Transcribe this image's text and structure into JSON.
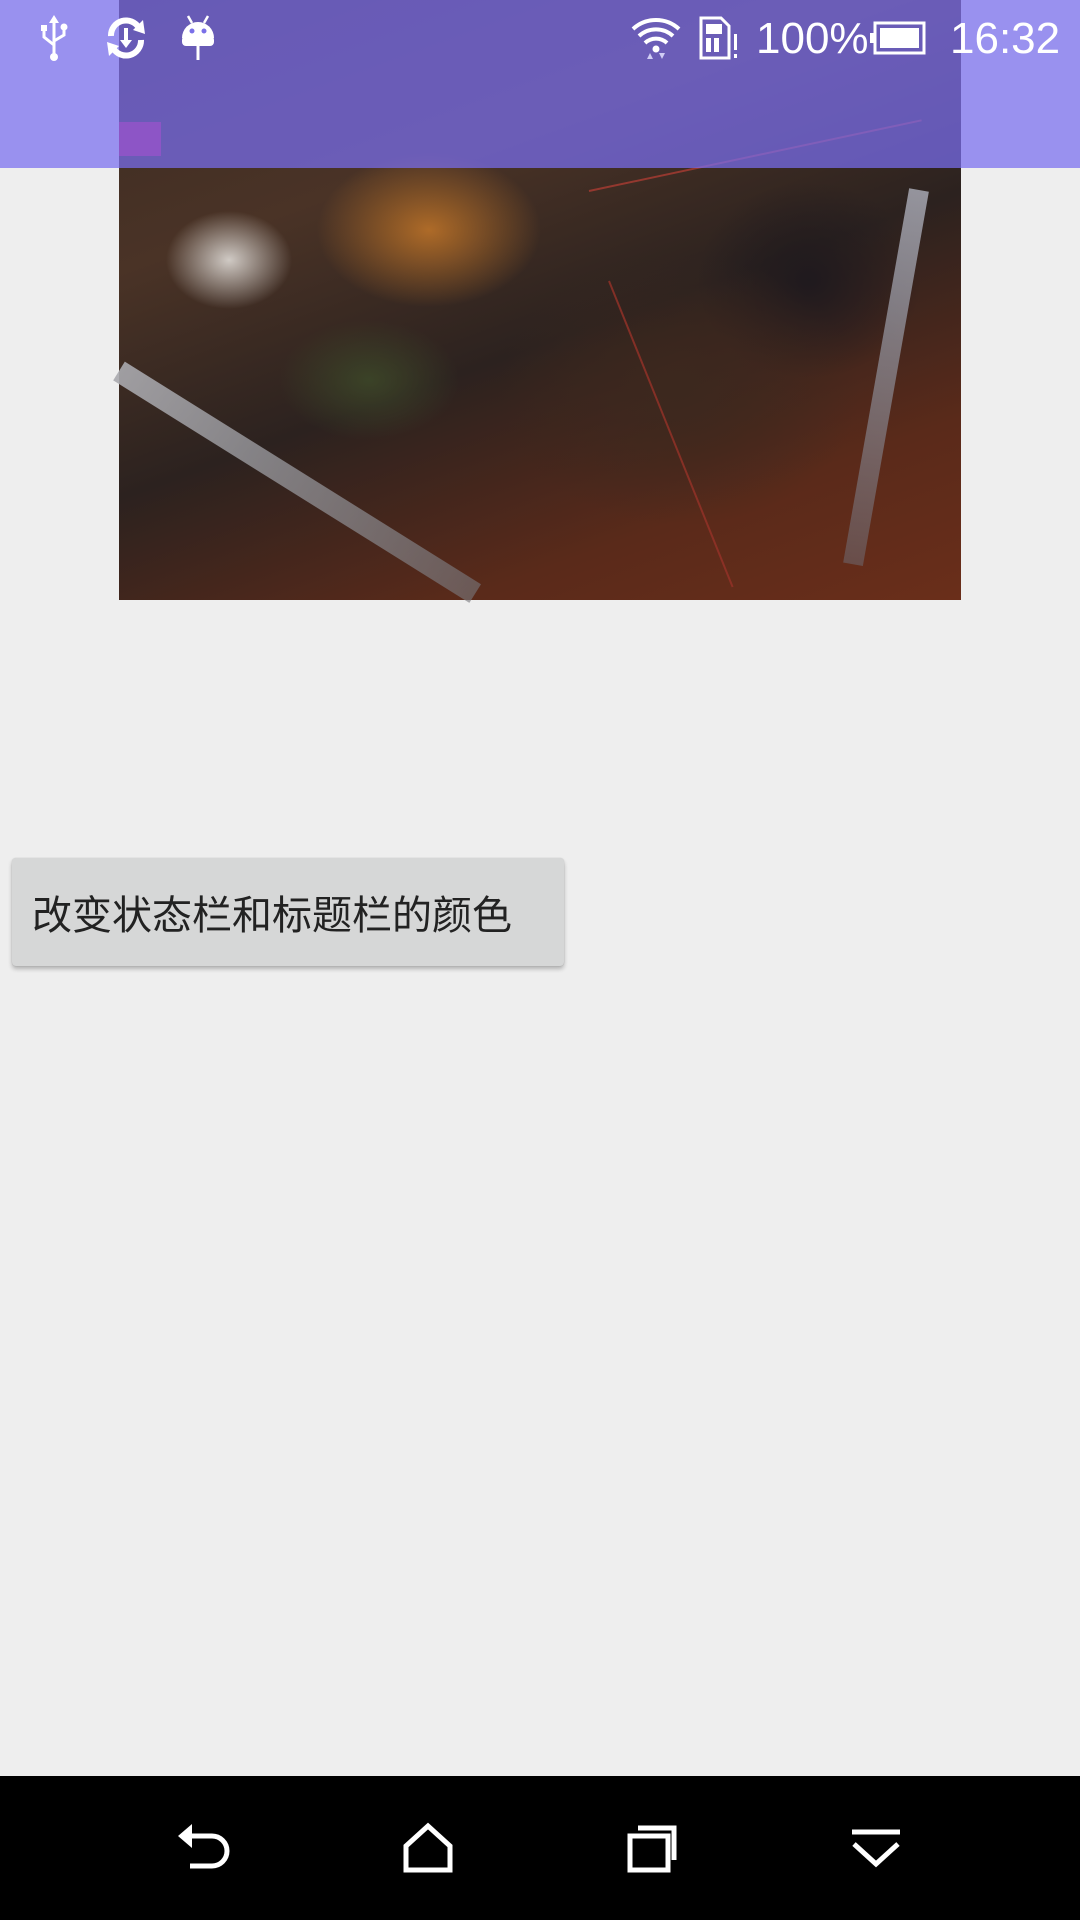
{
  "status_bar": {
    "battery_percent": "100%",
    "time": "16:32",
    "icons": [
      "usb-icon",
      "sync-icon",
      "android-debug-icon",
      "wifi-icon",
      "sim-card-icon",
      "battery-icon"
    ]
  },
  "main": {
    "button_label": "改变状态栏和标题栏的颜色"
  },
  "nav_bar": {
    "buttons": [
      "back-icon",
      "home-icon",
      "recents-icon",
      "notification-pulldown-icon"
    ]
  },
  "colors": {
    "status_overlay": "#786ef0",
    "background": "#eeeeee",
    "button_bg": "#d6d7d7",
    "nav_bg": "#000000"
  }
}
